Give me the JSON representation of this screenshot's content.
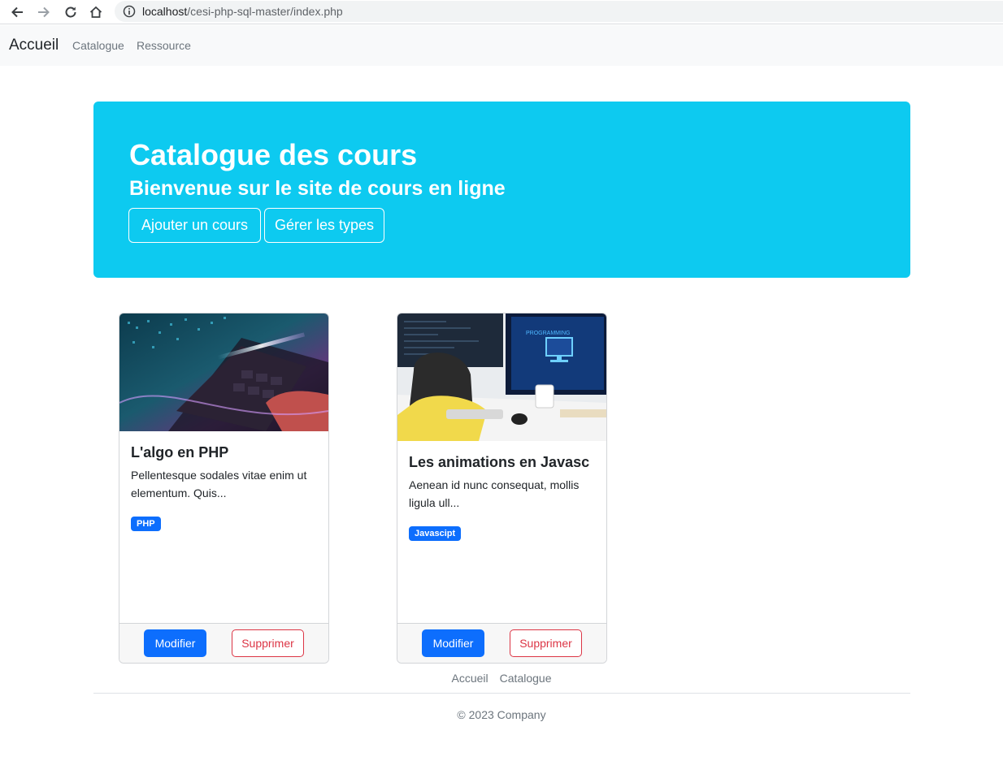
{
  "browser": {
    "url_host": "localhost",
    "url_path": "/cesi-php-sql-master/index.php"
  },
  "navbar": {
    "brand": "Accueil",
    "links": [
      "Catalogue",
      "Ressource"
    ]
  },
  "hero": {
    "title": "Catalogue des cours",
    "subtitle": "Bienvenue sur le site de cours en ligne",
    "buttons": [
      "Ajouter un cours",
      "Gérer les types"
    ]
  },
  "courses": [
    {
      "title": "L'algo en PHP",
      "description": "Pellentesque sodales vitae enim ut elementum. Quis...",
      "badge": "PHP",
      "edit_label": "Modifier",
      "delete_label": "Supprimer"
    },
    {
      "title": "Les animations en Javasc",
      "description": "Aenean id nunc consequat, mollis ligula ull...",
      "badge": "Javascipt",
      "edit_label": "Modifier",
      "delete_label": "Supprimer"
    }
  ],
  "footer": {
    "links": [
      "Accueil",
      "Catalogue"
    ],
    "copyright": "© 2023 Company"
  },
  "colors": {
    "hero_bg": "#0dcaf0",
    "primary": "#0d6efd",
    "danger": "#dc3545"
  }
}
